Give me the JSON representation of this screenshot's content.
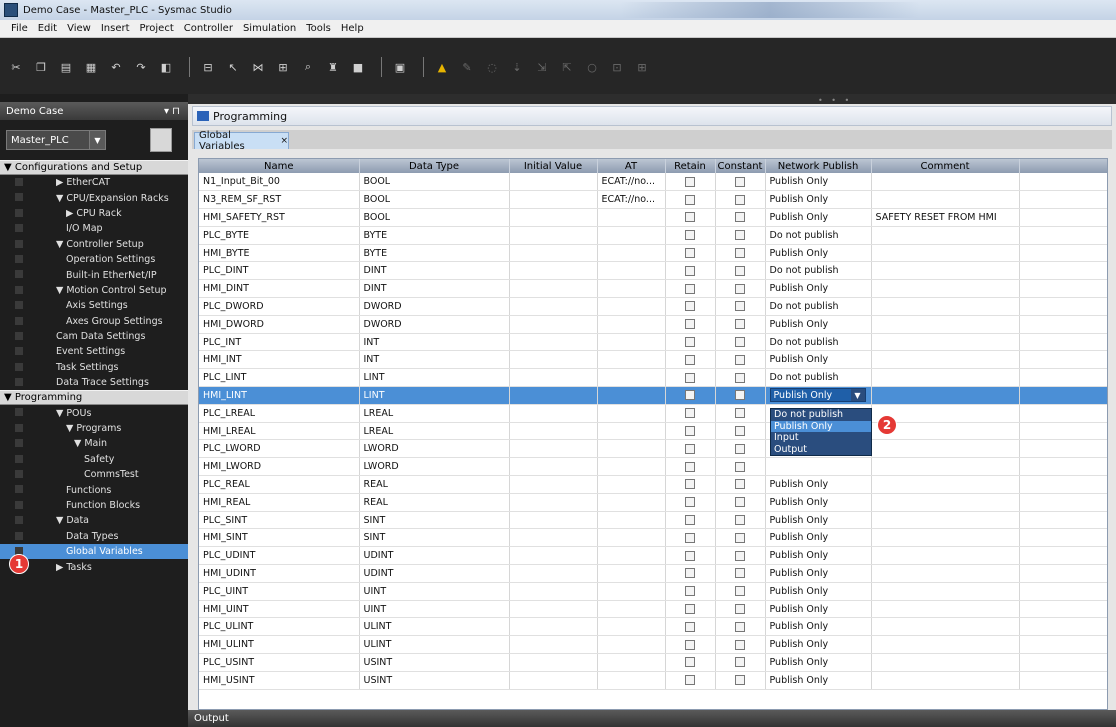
{
  "window": {
    "title": "Demo Case - Master_PLC - Sysmac Studio"
  },
  "menu": [
    "File",
    "Edit",
    "View",
    "Insert",
    "Project",
    "Controller",
    "Simulation",
    "Tools",
    "Help"
  ],
  "toolbar": {
    "icons": [
      "cut-icon",
      "copy-icon",
      "paste-icon",
      "delete-icon",
      "undo-icon",
      "redo-icon",
      "build-icon",
      "online-icon",
      "sync-icon",
      "compare-icon",
      "transfer-icon",
      "search-icon",
      "cross-ref-icon",
      "stop-icon",
      "monitor-icon",
      "warning-icon",
      "forced-icon",
      "trace-icon",
      "step-icon",
      "step-in-icon",
      "step-out-icon",
      "reset-icon",
      "pause-icon",
      "run-icon"
    ]
  },
  "left_panel": {
    "header": "Demo Case",
    "controller": "Master_PLC",
    "section_config": "▼ Configurations and Setup",
    "config_items": [
      "▶ EtherCAT",
      "▼ CPU/Expansion Racks",
      "▶ CPU Rack",
      "I/O Map",
      "▼ Controller Setup",
      "Operation Settings",
      "Built-in EtherNet/IP",
      "▼ Motion Control Setup",
      "Axis Settings",
      "Axes Group Settings",
      "Cam Data Settings",
      "Event Settings",
      "Task Settings",
      "Data Trace Settings"
    ],
    "section_programming": "▼ Programming",
    "programming_items": [
      "▼ POUs",
      "▼ Programs",
      "▼ Main",
      "Safety",
      "CommsTest",
      "Functions",
      "Function Blocks",
      "▼ Data",
      "Data Types",
      "Global Variables",
      "▶ Tasks"
    ],
    "badge1": "1"
  },
  "main": {
    "panel_title": "Programming",
    "tab_label": "Global Variables",
    "tab_close": "×",
    "columns": [
      "Name",
      "Data Type",
      "Initial Value",
      "AT",
      "Retain",
      "Constant",
      "Network Publish",
      "Comment"
    ],
    "rows": [
      {
        "name": "N1_Input_Bit_00",
        "type": "BOOL",
        "init": "",
        "at": "ECAT://no...",
        "publish": "Publish Only",
        "comment": ""
      },
      {
        "name": "N3_REM_SF_RST",
        "type": "BOOL",
        "init": "",
        "at": "ECAT://no...",
        "publish": "Publish Only",
        "comment": ""
      },
      {
        "name": "HMI_SAFETY_RST",
        "type": "BOOL",
        "init": "",
        "at": "",
        "publish": "Publish Only",
        "comment": "SAFETY RESET FROM HMI"
      },
      {
        "name": "PLC_BYTE",
        "type": "BYTE",
        "init": "",
        "at": "",
        "publish": "Do not publish",
        "comment": ""
      },
      {
        "name": "HMI_BYTE",
        "type": "BYTE",
        "init": "",
        "at": "",
        "publish": "Publish Only",
        "comment": ""
      },
      {
        "name": "PLC_DINT",
        "type": "DINT",
        "init": "",
        "at": "",
        "publish": "Do not publish",
        "comment": ""
      },
      {
        "name": "HMI_DINT",
        "type": "DINT",
        "init": "",
        "at": "",
        "publish": "Publish Only",
        "comment": ""
      },
      {
        "name": "PLC_DWORD",
        "type": "DWORD",
        "init": "",
        "at": "",
        "publish": "Do not publish",
        "comment": ""
      },
      {
        "name": "HMI_DWORD",
        "type": "DWORD",
        "init": "",
        "at": "",
        "publish": "Publish Only",
        "comment": ""
      },
      {
        "name": "PLC_INT",
        "type": "INT",
        "init": "",
        "at": "",
        "publish": "Do not publish",
        "comment": ""
      },
      {
        "name": "HMI_INT",
        "type": "INT",
        "init": "",
        "at": "",
        "publish": "Publish Only",
        "comment": ""
      },
      {
        "name": "PLC_LINT",
        "type": "LINT",
        "init": "",
        "at": "",
        "publish": "Do not publish",
        "comment": ""
      },
      {
        "name": "HMI_LINT",
        "type": "LINT",
        "init": "",
        "at": "",
        "publish": "Publish Only",
        "comment": "",
        "selected": true
      },
      {
        "name": "PLC_LREAL",
        "type": "LREAL",
        "init": "",
        "at": "",
        "publish": "",
        "comment": ""
      },
      {
        "name": "HMI_LREAL",
        "type": "LREAL",
        "init": "",
        "at": "",
        "publish": "",
        "comment": ""
      },
      {
        "name": "PLC_LWORD",
        "type": "LWORD",
        "init": "",
        "at": "",
        "publish": "",
        "comment": ""
      },
      {
        "name": "HMI_LWORD",
        "type": "LWORD",
        "init": "",
        "at": "",
        "publish": "",
        "comment": ""
      },
      {
        "name": "PLC_REAL",
        "type": "REAL",
        "init": "",
        "at": "",
        "publish": "Publish Only",
        "comment": ""
      },
      {
        "name": "HMI_REAL",
        "type": "REAL",
        "init": "",
        "at": "",
        "publish": "Publish Only",
        "comment": ""
      },
      {
        "name": "PLC_SINT",
        "type": "SINT",
        "init": "",
        "at": "",
        "publish": "Publish Only",
        "comment": ""
      },
      {
        "name": "HMI_SINT",
        "type": "SINT",
        "init": "",
        "at": "",
        "publish": "Publish Only",
        "comment": ""
      },
      {
        "name": "PLC_UDINT",
        "type": "UDINT",
        "init": "",
        "at": "",
        "publish": "Publish Only",
        "comment": ""
      },
      {
        "name": "HMI_UDINT",
        "type": "UDINT",
        "init": "",
        "at": "",
        "publish": "Publish Only",
        "comment": ""
      },
      {
        "name": "PLC_UINT",
        "type": "UINT",
        "init": "",
        "at": "",
        "publish": "Publish Only",
        "comment": ""
      },
      {
        "name": "HMI_UINT",
        "type": "UINT",
        "init": "",
        "at": "",
        "publish": "Publish Only",
        "comment": ""
      },
      {
        "name": "PLC_ULINT",
        "type": "ULINT",
        "init": "",
        "at": "",
        "publish": "Publish Only",
        "comment": ""
      },
      {
        "name": "HMI_ULINT",
        "type": "ULINT",
        "init": "",
        "at": "",
        "publish": "Publish Only",
        "comment": ""
      },
      {
        "name": "PLC_USINT",
        "type": "USINT",
        "init": "",
        "at": "",
        "publish": "Publish Only",
        "comment": ""
      },
      {
        "name": "HMI_USINT",
        "type": "USINT",
        "init": "",
        "at": "",
        "publish": "Publish Only",
        "comment": ""
      }
    ],
    "dropdown_options": [
      "Do not publish",
      "Publish Only",
      "Input",
      "Output"
    ],
    "badge2": "2"
  },
  "output": {
    "label": "Output"
  },
  "colors": {
    "selection": "#4b8fd6",
    "badge": "#e53935",
    "dropdown": "#2a4d7e"
  }
}
